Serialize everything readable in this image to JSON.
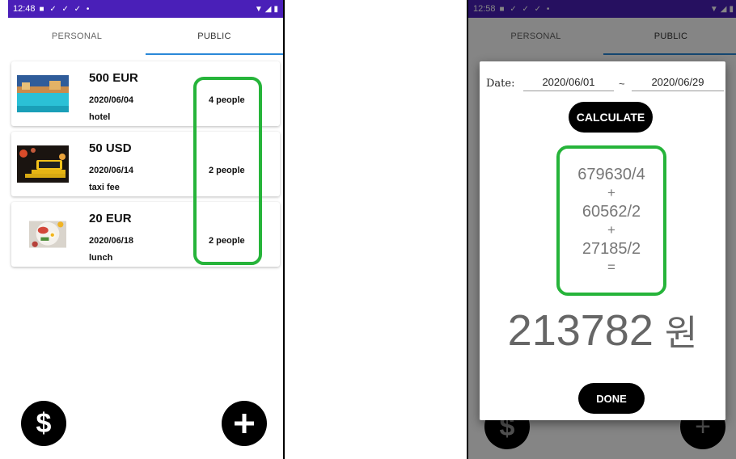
{
  "left_screen": {
    "status": {
      "time": "12:48",
      "notification_icons": "■ ✓ ✓ ✓ •"
    },
    "tabs": [
      {
        "label": "PERSONAL",
        "active": false
      },
      {
        "label": "PUBLIC",
        "active": true
      }
    ],
    "items": [
      {
        "amount": "500 EUR",
        "date": "2020/06/04",
        "description": "hotel",
        "people": "4 people",
        "image": "hotel-pool-image"
      },
      {
        "amount": "50 USD",
        "date": "2020/06/14",
        "description": "taxi fee",
        "people": "2 people",
        "image": "taxi-sign-image"
      },
      {
        "amount": "20 EUR",
        "date": "2020/06/18",
        "description": "lunch",
        "people": "2 people",
        "image": "lunch-plate-image"
      }
    ],
    "fab_dollar_label": "$",
    "fab_add_label": "+"
  },
  "right_screen": {
    "status": {
      "time": "12:58",
      "notification_icons": "■ ✓ ✓ ✓ •"
    },
    "tabs": [
      {
        "label": "PERSONAL",
        "active": false
      },
      {
        "label": "PUBLIC",
        "active": true
      }
    ],
    "dialog": {
      "date_label": "Date:",
      "date_from": "2020/06/01",
      "date_separator": "~",
      "date_to": "2020/06/29",
      "calculate_label": "CALCULATE",
      "formula": {
        "term1": "679630/4",
        "op1": "+",
        "term2": "60562/2",
        "op2": "+",
        "term3": "27185/2",
        "equals": "="
      },
      "result_value": "213782",
      "result_unit": "원",
      "done_label": "DONE"
    }
  },
  "colors": {
    "status_bar": "#4a1fb8",
    "tab_indicator": "#2a88d8",
    "highlight": "#26b43a",
    "button": "#000000"
  }
}
